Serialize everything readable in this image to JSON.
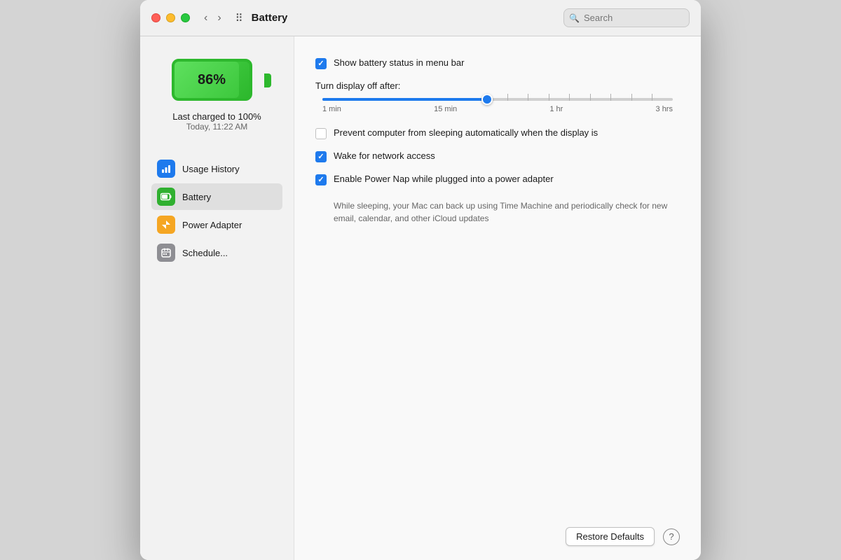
{
  "window": {
    "title": "Battery",
    "search_placeholder": "Search"
  },
  "traffic_lights": {
    "close": "close",
    "minimize": "minimize",
    "maximize": "maximize"
  },
  "battery": {
    "percent": "86%",
    "charge_title": "Last charged to 100%",
    "charge_time": "Today, 11:22 AM"
  },
  "sidebar": {
    "items": [
      {
        "id": "usage-history",
        "label": "Usage History",
        "icon": "📊",
        "icon_class": "icon-blue"
      },
      {
        "id": "battery",
        "label": "Battery",
        "icon": "🔋",
        "icon_class": "icon-green"
      },
      {
        "id": "power-adapter",
        "label": "Power Adapter",
        "icon": "⚡",
        "icon_class": "icon-orange"
      },
      {
        "id": "schedule",
        "label": "Schedule...",
        "icon": "📅",
        "icon_class": "icon-gray"
      }
    ]
  },
  "settings": {
    "show_battery_status": {
      "label": "Show battery status in menu bar",
      "checked": true
    },
    "turn_display_off": {
      "label": "Turn display off after:",
      "slider_labels": [
        "1 min",
        "15 min",
        "1 hr",
        "3 hrs"
      ]
    },
    "prevent_sleeping": {
      "label": "Prevent computer from sleeping automatically when the display is",
      "checked": false
    },
    "wake_network": {
      "label": "Wake for network access",
      "checked": true
    },
    "power_nap": {
      "label": "Enable Power Nap while plugged into a power adapter",
      "checked": true,
      "description": "While sleeping, your Mac can back up using Time Machine and periodically check for new email, calendar, and other iCloud updates"
    }
  },
  "buttons": {
    "restore_defaults": "Restore Defaults",
    "help": "?"
  }
}
